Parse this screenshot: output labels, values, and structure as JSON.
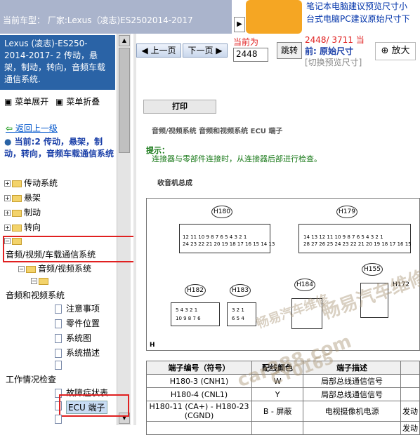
{
  "topbar": {
    "vehicle": "当前车型：  厂家:Lexus（凌志)ES2502014-2017",
    "arrow": "▶"
  },
  "banner": {
    "line1": "笔记本电脑建议预览尺寸小",
    "line2": "台式电脑PC建议原始尺寸下"
  },
  "sidebar": {
    "title": "Lexus (凌志)-ES250-2014-2017- 2 传动，悬架，制动，转向，音频车载通信系统.",
    "expand": "菜单展开",
    "collapse": "菜单折叠",
    "back": "返回上一级",
    "current": "当前:2 传动，悬架，制动，转向，音频车载通信系统",
    "tree": [
      "传动系统",
      "悬架",
      "制动",
      "转向",
      "音频/视频/车载通信系统",
      "音频/视频系统",
      "音频和视频系统",
      "注意事项",
      "零件位置",
      "系统图",
      "系统描述",
      "工作情况检查",
      "故障症状表",
      "ECU 端子"
    ]
  },
  "nav": {
    "prev": "上一页",
    "next": "下一页",
    "current_label": "当前为",
    "page_value": "2448",
    "jump": "跳转",
    "page_count": "2448/ 3711 当",
    "original_size": "前: 原始尺寸",
    "toggle_preview": "[切换预览尺寸]",
    "zoom": "放大"
  },
  "doc": {
    "print": "打印",
    "breadcrumb": "音频/视频系统 音频和视频系统 ECU 端子",
    "hint_title": "提示：",
    "hint_body": "连接器与零部件连接时，从连接器后部进行检查。",
    "section": "收音机总成",
    "connectors": [
      "H180",
      "H179",
      "H155",
      "H182",
      "H183",
      "H184",
      "H172"
    ],
    "h180_pins": [
      "12 11 10 9 8 7 6 5 4 3 2 1",
      "24 23 22 21 20 19 18 17 16 15 14 13"
    ],
    "h179_pins": [
      "14 13 12 11 10 9 8 7 6 5 4 3 2 1",
      "28 27 26 25 24 23 22 21 20 19 18 17 16 15"
    ],
    "h182_pins": [
      "5 4 3 2 1",
      "10 9 8 7 6"
    ],
    "h183_pins": [
      "3 2 1",
      "6 5 4"
    ],
    "corner": "H",
    "table_headers": [
      "端子编号（符号）",
      "配线颜色",
      "端子描述"
    ],
    "rows": [
      [
        "H180-3 (CNH1)",
        "W",
        "局部总线通信信号"
      ],
      [
        "H180-4 (CNL1)",
        "Y",
        "局部总线通信信号"
      ],
      [
        "H180-11 (CA+) - H180-23 (CGND)",
        "B - 屏蔽",
        "电视摄像机电源"
      ]
    ],
    "row3_extra": "发动",
    "row4_extra": "发动"
  },
  "watermarks": [
    "畅易汽车维修",
    "car388.com",
    "CY0165",
    "畅易汽车维修"
  ]
}
